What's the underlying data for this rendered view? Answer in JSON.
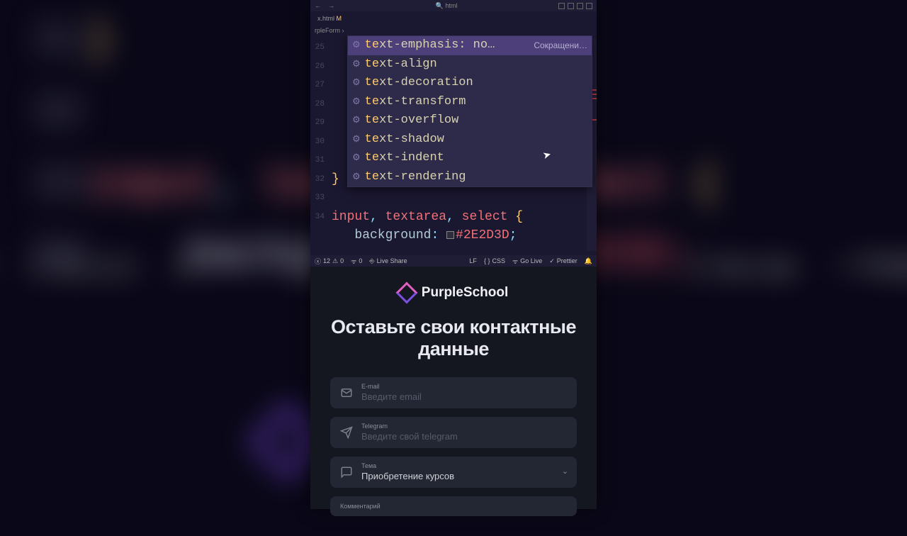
{
  "editor": {
    "topbar_search": "html",
    "tab": {
      "name": "x.html",
      "modified_marker": "M"
    },
    "breadcrumb": "rpleForm",
    "line_numbers": [
      "25",
      "26",
      "27",
      "28",
      "29",
      "30",
      "31",
      "32",
      "33",
      "34"
    ],
    "typed": "te",
    "code_tail": {
      "selector": "input, textarea, select {",
      "prop": "background",
      "hex": "#2E2D3D"
    },
    "autocomplete_hint": "Сокращени…",
    "autocomplete": [
      {
        "label": "text-emphasis: no…",
        "selected": true
      },
      {
        "label": "text-align"
      },
      {
        "label": "text-decoration"
      },
      {
        "label": "text-transform"
      },
      {
        "label": "text-overflow"
      },
      {
        "label": "text-shadow"
      },
      {
        "label": "text-indent"
      },
      {
        "label": "text-rendering"
      }
    ]
  },
  "statusbar": {
    "errors": "12",
    "warnings": "0",
    "ports": "0",
    "live_share": "Live Share",
    "eol": "LF",
    "lang": "CSS",
    "go_live": "Go Live",
    "prettier": "Prettier"
  },
  "bg_status": {
    "errors": "12",
    "warnings": "0",
    "go_live": "Go Live",
    "prettier": "Prettier"
  },
  "preview": {
    "brand": "PurpleSchool",
    "headline": "Оставьте свои контактные данные",
    "fields": {
      "email": {
        "label": "E-mail",
        "placeholder": "Введите email"
      },
      "telegram": {
        "label": "Telegram",
        "placeholder": "Введите свой telegram"
      },
      "topic": {
        "label": "Тема",
        "value": "Приобретение курсов"
      },
      "comment": {
        "label": "Комментарий"
      }
    }
  },
  "bg_code": {
    "l31_num": "31",
    "l31_brace": "}",
    "l32_num": "32",
    "l33_num": "33",
    "l33_sel": "input, textarea, select {",
    "l34_num": "34",
    "l34_prop": "background",
    "l34_hex": "#2E2D3D;"
  }
}
